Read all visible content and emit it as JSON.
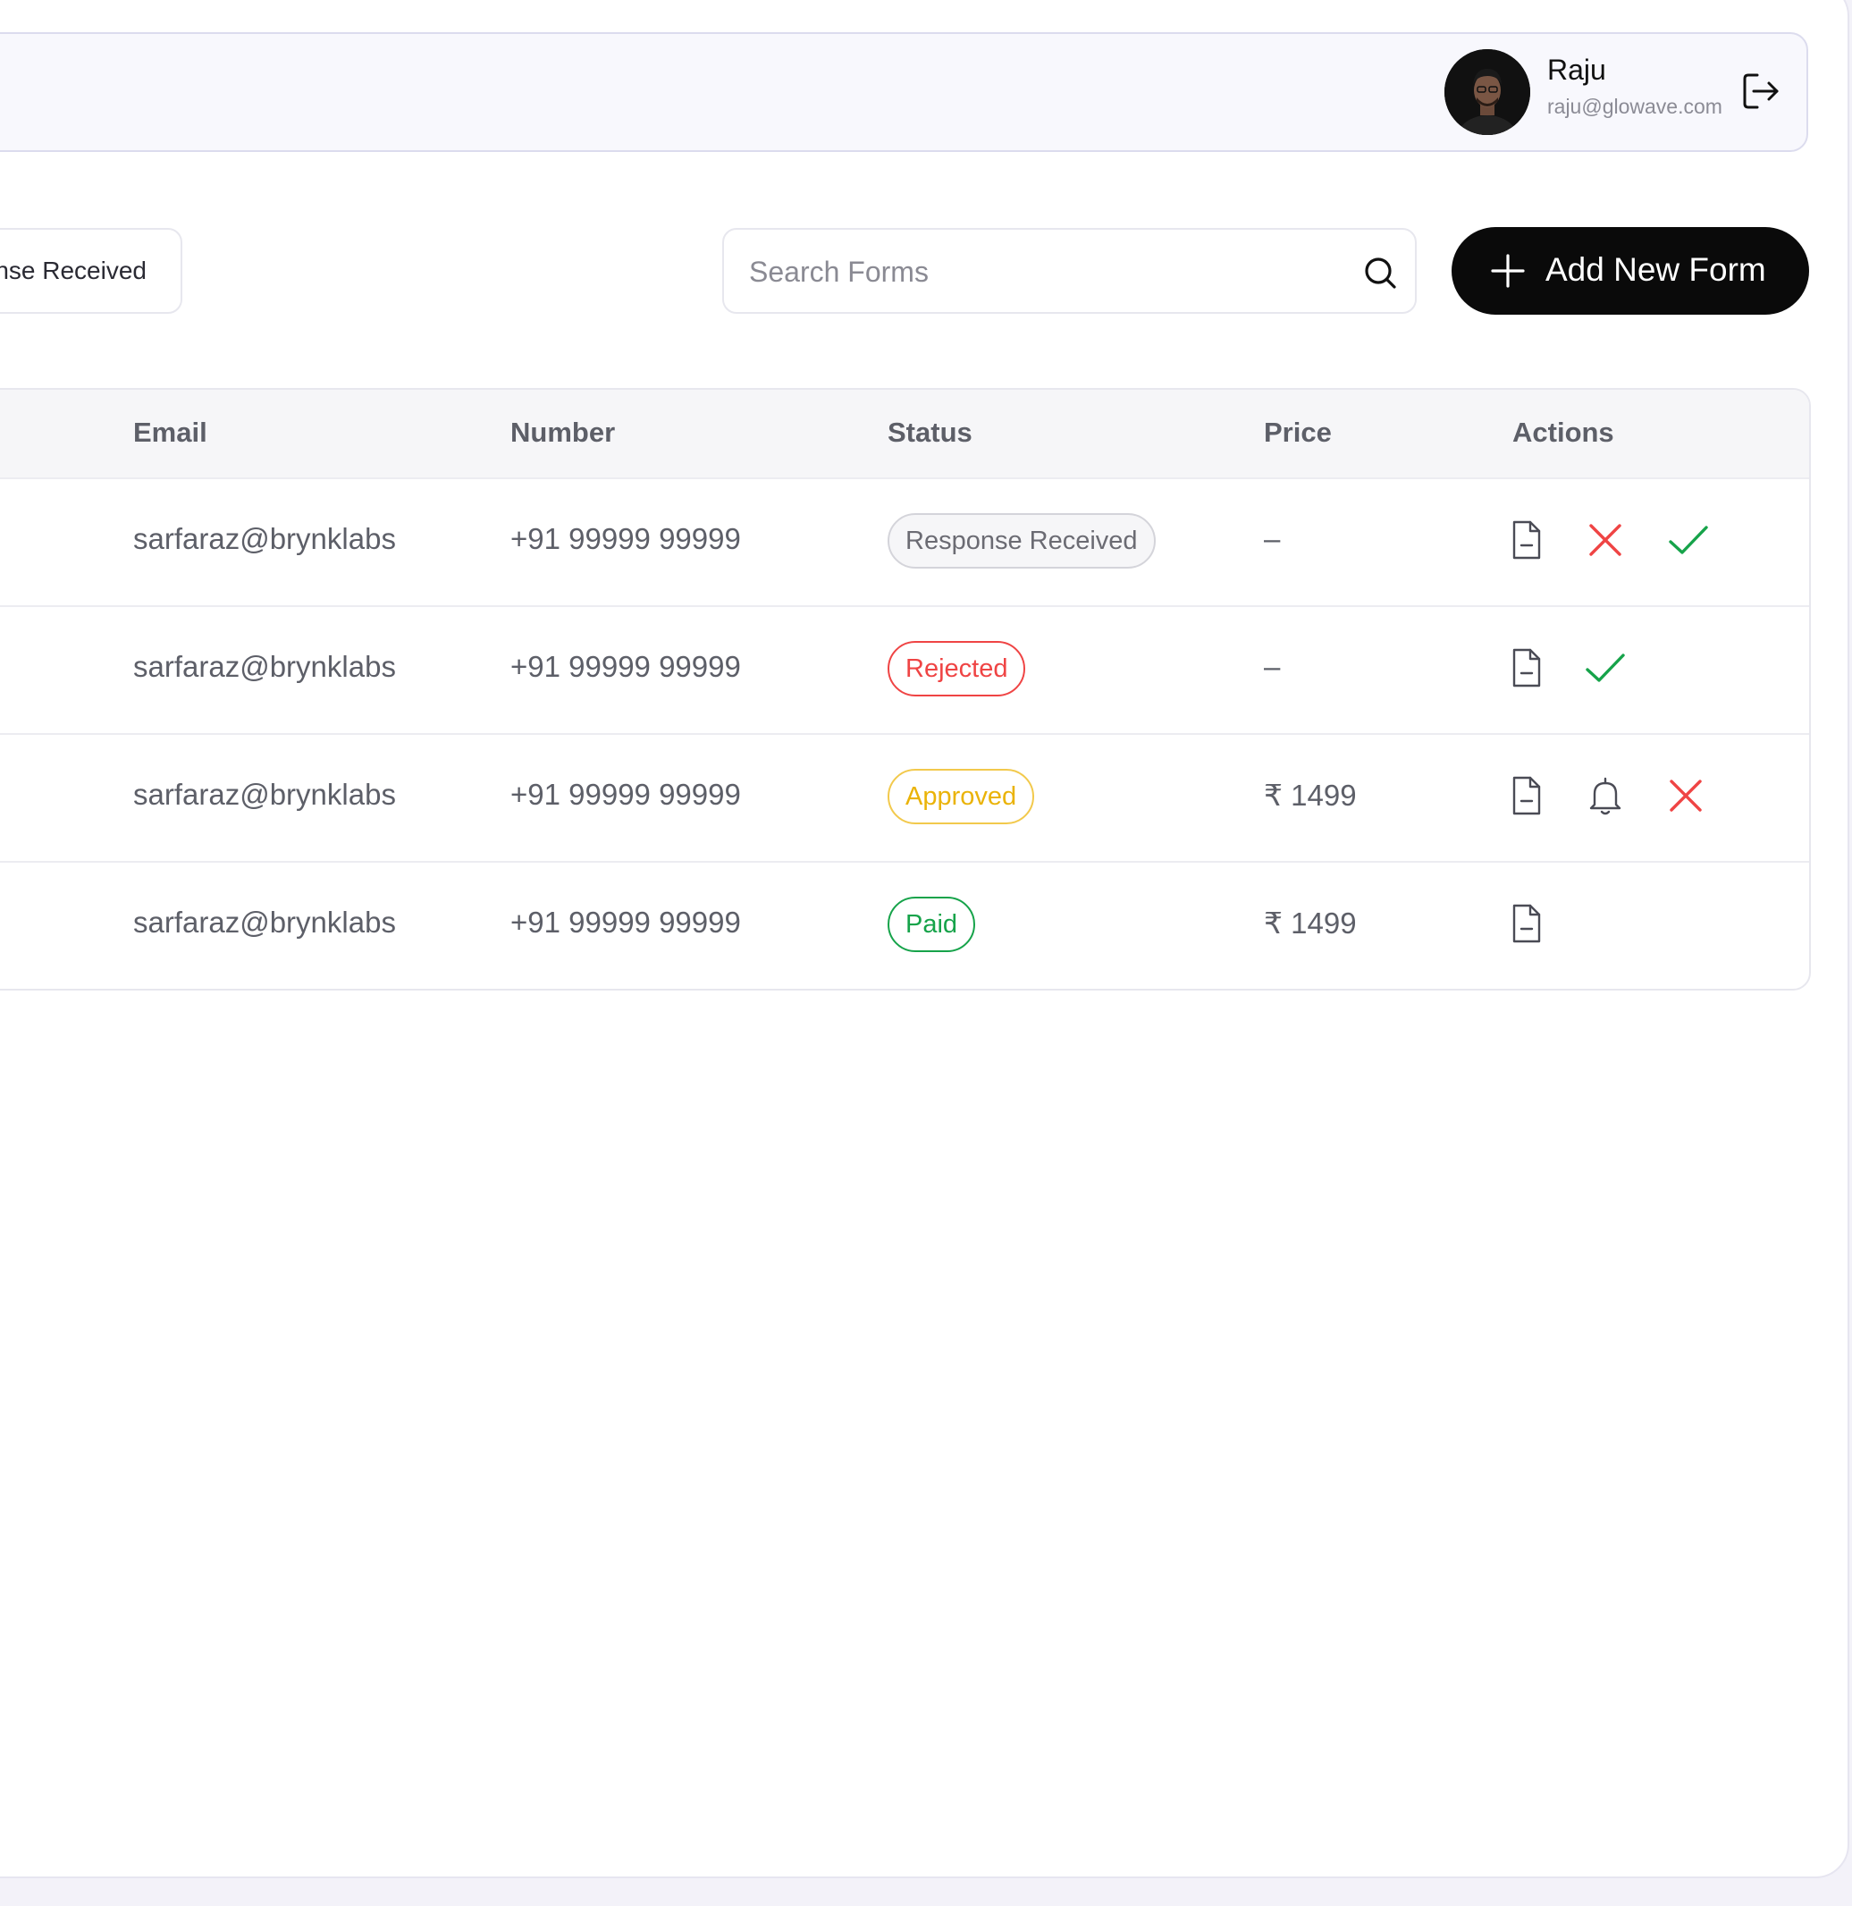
{
  "header": {
    "user_name": "Raju",
    "user_email": "raju@glowave.com"
  },
  "toolbar": {
    "filter_label": "nse Received",
    "search_placeholder": "Search Forms",
    "search_value": "",
    "add_button_label": "Add New Form"
  },
  "table": {
    "columns": [
      "Email",
      "Number",
      "Status",
      "Price",
      "Actions"
    ],
    "rows": [
      {
        "email": "sarfaraz@brynklabs",
        "number": "+91 99999 99999",
        "status": "Response Received",
        "price": "–",
        "actions": [
          "document-icon",
          "reject-icon",
          "approve-icon"
        ]
      },
      {
        "email": "sarfaraz@brynklabs",
        "number": "+91 99999 99999",
        "status": "Rejected",
        "price": "–",
        "actions": [
          "document-icon",
          "approve-icon"
        ]
      },
      {
        "email": "sarfaraz@brynklabs",
        "number": "+91 99999 99999",
        "status": "Approved",
        "price": "₹ 1499",
        "actions": [
          "document-icon",
          "bell-icon",
          "reject-icon"
        ]
      },
      {
        "email": "sarfaraz@brynklabs",
        "number": "+91 99999 99999",
        "status": "Paid",
        "price": "₹ 1499",
        "actions": [
          "document-icon"
        ]
      }
    ]
  },
  "colors": {
    "status_response_received": "#6b6b73",
    "status_rejected": "#ef4444",
    "status_approved": "#eab308",
    "status_paid": "#16a34a",
    "primary_button": "#0a0a0a",
    "approve_icon": "#16a34a",
    "reject_icon": "#ef4444"
  }
}
